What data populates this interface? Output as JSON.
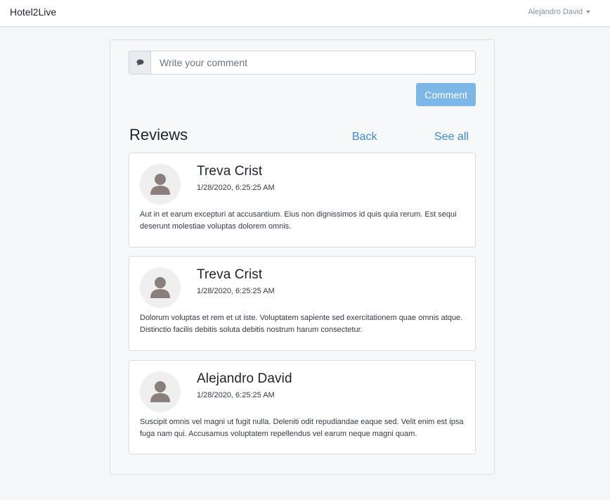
{
  "navbar": {
    "brand": "Hotel2Live",
    "user_name": "Alejandro David"
  },
  "comment": {
    "placeholder": "Write your comment",
    "button_label": "Comment"
  },
  "reviews": {
    "title": "Reviews",
    "back_label": "Back",
    "see_all_label": "See all",
    "items": [
      {
        "name": "Treva Crist",
        "date": "1/28/2020, 6:25:25 AM",
        "text": "Aut in et earum excepturi at accusantium. Eius non dignissimos id quis quia rerum. Est sequi deserunt molestiae voluptas dolorem omnis."
      },
      {
        "name": "Treva Crist",
        "date": "1/28/2020, 6:25:25 AM",
        "text": "Dolorum voluptas et rem et ut iste. Voluptatem sapiente sed exercitationem quae omnis atque. Distinctio facilis debitis soluta debitis nostrum harum consectetur."
      },
      {
        "name": "Alejandro David",
        "date": "1/28/2020, 6:25:25 AM",
        "text": "Suscipit omnis vel magni ut fugit nulla. Deleniti odit repudiandae eaque sed. Velit enim est ipsa fuga nam qui. Accusamus voluptatem repellendus vel earum neque magni quam."
      }
    ]
  },
  "colors": {
    "accent": "#3b8ad4",
    "button": "#7db7e8",
    "avatar_fill": "#8a7f7d",
    "avatar_bg": "#efefef"
  },
  "icons": {
    "comment_addon": "comment-icon",
    "avatar": "user-avatar-icon",
    "dropdown": "caret-down-icon"
  }
}
